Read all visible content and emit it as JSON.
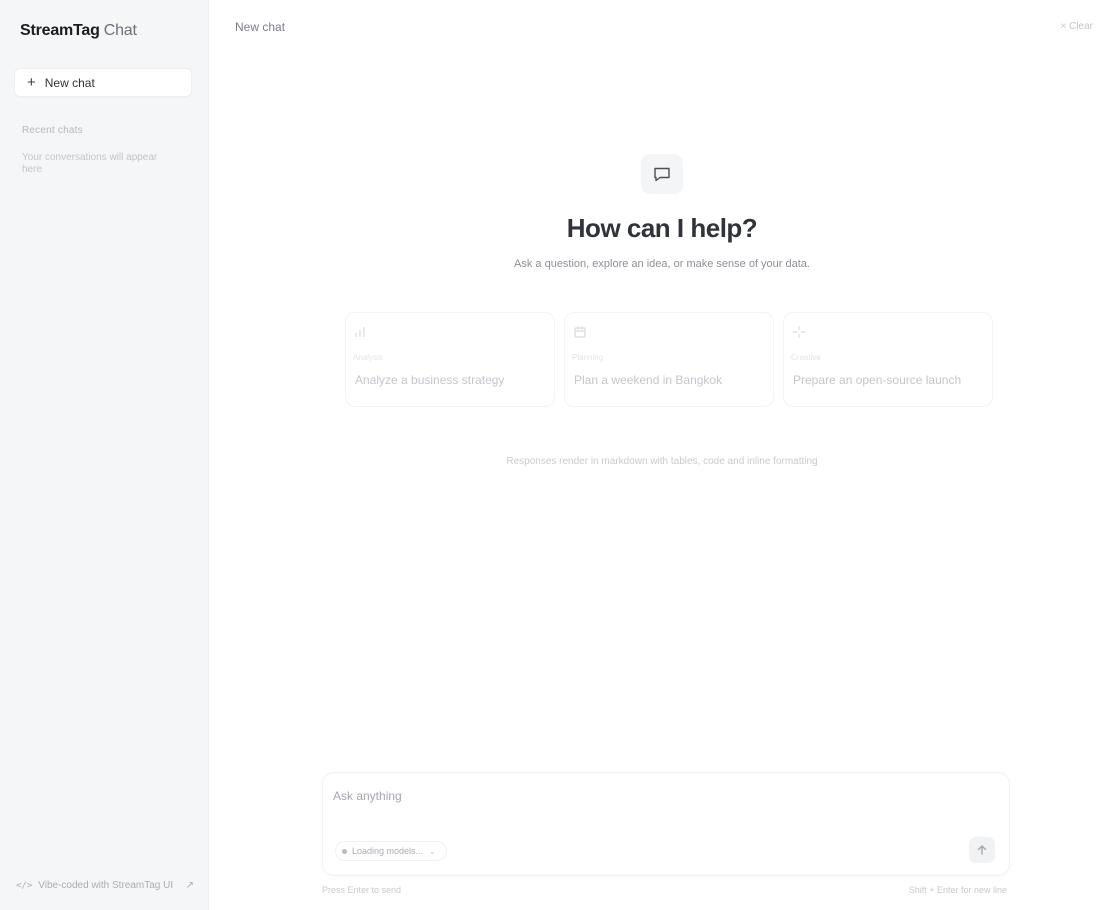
{
  "sidebar": {
    "brand_name": "StreamTag",
    "brand_suffix": "Chat",
    "new_chat_label": "New chat",
    "recent_title": "Recent chats",
    "recent_empty": "Your conversations will appear here",
    "footer_label": "Vibe-coded with StreamTag UI"
  },
  "topbar": {
    "title": "New chat",
    "clear_label": "Clear"
  },
  "hero": {
    "title": "How can I help?",
    "subtitle": "Ask a question, explore an idea, or make sense of your data."
  },
  "cards": [
    {
      "tag": "Analysis",
      "text": "Analyze a business strategy",
      "icon": "chart-icon"
    },
    {
      "tag": "Planning",
      "text": "Plan a weekend in Bangkok",
      "icon": "calendar-icon"
    },
    {
      "tag": "Creative",
      "text": "Prepare an open-source launch",
      "icon": "sparkle-icon"
    }
  ],
  "footnote": "Responses render in markdown with tables, code and inline formatting",
  "composer": {
    "placeholder": "Ask anything",
    "model_label": "Loading models...",
    "hint_left": "Press Enter to send",
    "hint_right": "Shift + Enter for new line"
  }
}
